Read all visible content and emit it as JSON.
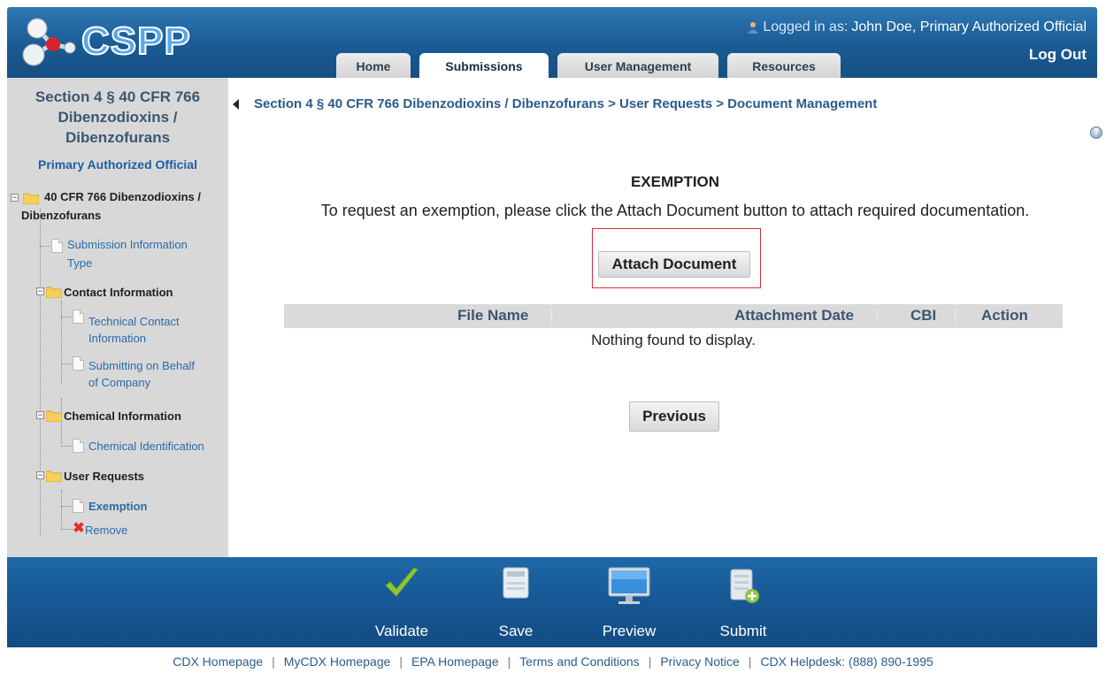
{
  "header": {
    "logo_text": "CSPP",
    "logged_in_label": "Logged in as:",
    "user_name": "John Doe, Primary Authorized Official",
    "logout_label": "Log Out",
    "tabs": [
      {
        "label": "Home",
        "active": false
      },
      {
        "label": "Submissions",
        "active": true
      },
      {
        "label": "User Management",
        "active": false
      },
      {
        "label": "Resources",
        "active": false
      }
    ]
  },
  "sidebar": {
    "title_lines": [
      "Section 4 § 40 CFR 766",
      "Dibenzodioxins /",
      "Dibenzofurans"
    ],
    "role": "Primary Authorized Official",
    "tree": {
      "root_lines": [
        "40 CFR 766 Dibenzodioxins /",
        "Dibenzofurans"
      ],
      "submission_info_lines": [
        "Submission Information",
        "Type"
      ],
      "contact_info": "Contact Information",
      "technical_contact_lines": [
        "Technical Contact",
        "Information"
      ],
      "submitting_behalf_lines": [
        "Submitting on Behalf",
        "of Company"
      ],
      "chemical_info": "Chemical Information",
      "chemical_identification": "Chemical Identification",
      "user_requests": "User Requests",
      "exemption": "Exemption",
      "remove": "Remove"
    }
  },
  "main": {
    "breadcrumb": "Section 4 § 40 CFR 766 Dibenzodioxins / Dibenzofurans > User Requests > Document Management",
    "heading": "EXEMPTION",
    "description": "To request an exemption, please click the Attach Document button to attach required documentation.",
    "attach_button": "Attach Document",
    "table": {
      "headers": [
        "File Name",
        "Attachment Date",
        "CBI",
        "Action"
      ],
      "empty_message": "Nothing found to display."
    },
    "previous_button": "Previous"
  },
  "footer": {
    "actions": [
      {
        "label": "Validate",
        "icon": "checkmark-icon"
      },
      {
        "label": "Save",
        "icon": "save-icon"
      },
      {
        "label": "Preview",
        "icon": "monitor-icon"
      },
      {
        "label": "Submit",
        "icon": "database-submit-icon"
      }
    ],
    "links": [
      "CDX Homepage",
      "MyCDX Homepage",
      "EPA Homepage",
      "Terms and Conditions",
      "Privacy Notice",
      "CDX Helpdesk: (888) 890-1995"
    ]
  },
  "colors": {
    "header_blue": "#1a5a93",
    "footer_blue": "#175996",
    "sidebar_gray": "#d8d8d8",
    "link_blue": "#2b5b8c",
    "highlight_red": "#d6303a"
  }
}
